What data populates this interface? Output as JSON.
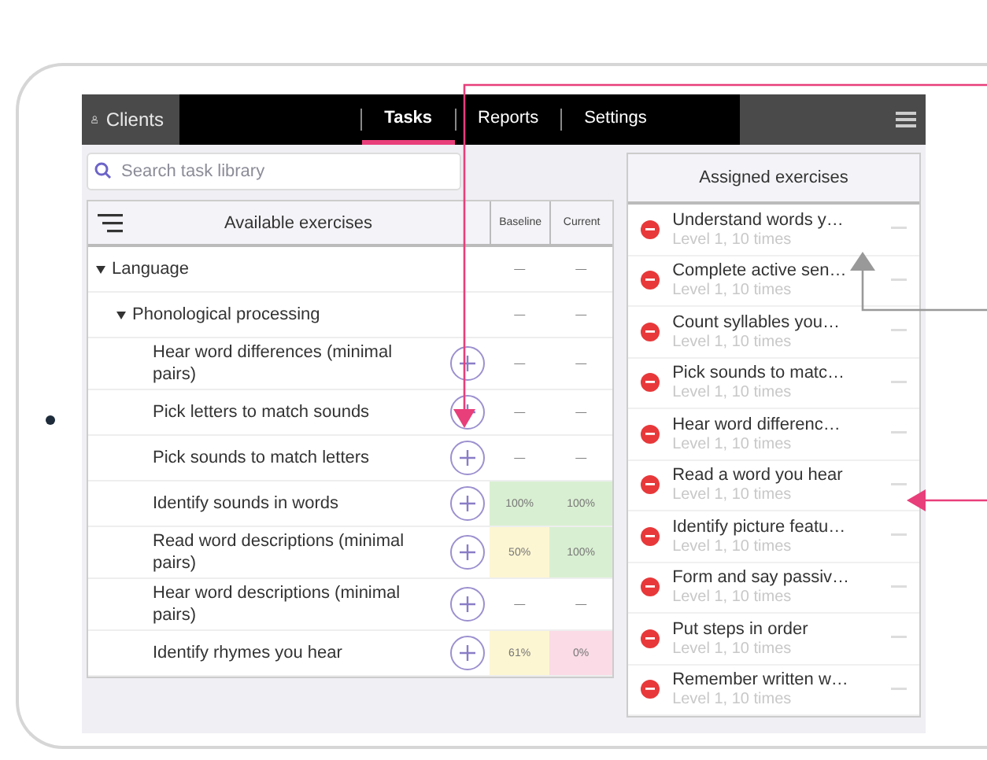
{
  "top_bar": {
    "clients_button": "Clients",
    "tabs": [
      {
        "label": "Tasks",
        "selected": true
      },
      {
        "label": "Reports",
        "selected": false
      },
      {
        "label": "Settings",
        "selected": false
      }
    ]
  },
  "search": {
    "placeholder": "Search task library"
  },
  "available": {
    "title": "Available exercises",
    "columns": [
      "Baseline",
      "Current"
    ],
    "rows": [
      {
        "kind": "group",
        "label": "Language",
        "expanded": true,
        "baseline": {
          "text": "—"
        },
        "current": {
          "text": "—"
        },
        "children": [
          {
            "kind": "group",
            "label": "Phonological processing",
            "expanded": true,
            "baseline": {
              "text": "—"
            },
            "current": {
              "text": "—"
            },
            "children": [
              {
                "kind": "exercise",
                "label": "Hear word differences (minimal pairs)",
                "baseline": {
                  "text": "—"
                },
                "current": {
                  "text": "—"
                }
              },
              {
                "kind": "exercise",
                "label": "Pick letters to match sounds",
                "baseline": {
                  "text": "—"
                },
                "current": {
                  "text": "—"
                }
              },
              {
                "kind": "exercise",
                "label": "Pick sounds to match letters",
                "baseline": {
                  "text": "—"
                },
                "current": {
                  "text": "—"
                }
              },
              {
                "kind": "exercise",
                "label": "Identify sounds in words",
                "baseline": {
                  "text": "100%",
                  "color": "#d9efd2"
                },
                "current": {
                  "text": "100%",
                  "color": "#d9efd2"
                }
              },
              {
                "kind": "exercise",
                "label": "Read word descriptions (minimal pairs)",
                "baseline": {
                  "text": "50%",
                  "color": "#fdf6d2"
                },
                "current": {
                  "text": "100%",
                  "color": "#d9efd2"
                }
              },
              {
                "kind": "exercise",
                "label": "Hear word descriptions (minimal pairs)",
                "baseline": {
                  "text": "—"
                },
                "current": {
                  "text": "—"
                }
              },
              {
                "kind": "exercise",
                "label": "Identify rhymes you hear",
                "baseline": {
                  "text": "61%",
                  "color": "#fdf6d2"
                },
                "current": {
                  "text": "0%",
                  "color": "#fadbe6"
                }
              }
            ]
          }
        ]
      }
    ]
  },
  "assigned": {
    "title": "Assigned exercises",
    "items": [
      {
        "title": "Understand words y…",
        "detail": "Level 1, 10 times"
      },
      {
        "title": "Complete active sen…",
        "detail": "Level 1, 10 times"
      },
      {
        "title": "Count syllables you…",
        "detail": "Level 1, 10 times"
      },
      {
        "title": "Pick sounds to matc…",
        "detail": "Level 1, 10 times"
      },
      {
        "title": "Hear word differenc…",
        "detail": "Level 1, 10 times"
      },
      {
        "title": "Read a word you hear",
        "detail": "Level 1, 10 times"
      },
      {
        "title": "Identify picture featu…",
        "detail": "Level 1, 10 times"
      },
      {
        "title": "Form and say passiv…",
        "detail": "Level 1, 10 times"
      },
      {
        "title": "Put steps in order",
        "detail": "Level 1, 10 times"
      },
      {
        "title": "Remember written w…",
        "detail": "Level 1, 10 times"
      }
    ]
  }
}
